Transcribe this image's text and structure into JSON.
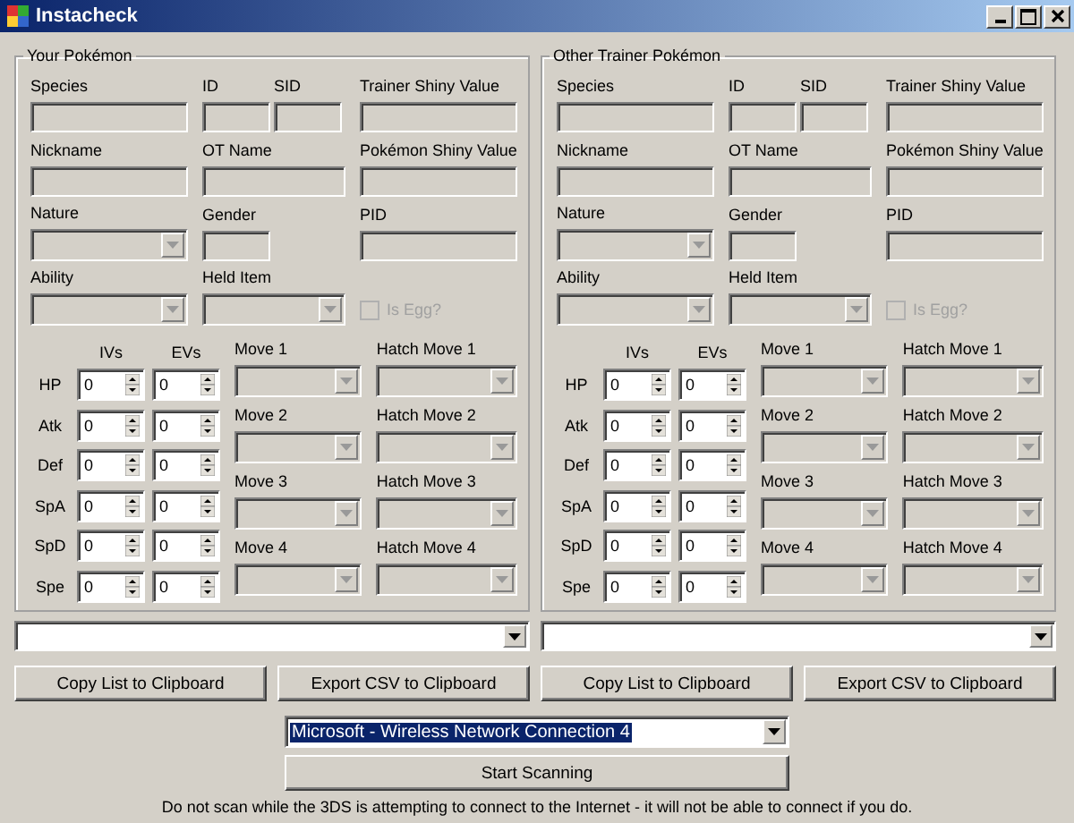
{
  "window": {
    "title": "Instacheck"
  },
  "panels": [
    {
      "title": "Your Pokémon",
      "rows": [
        [
          {
            "label": "Species",
            "kind": "text"
          },
          {
            "label": "ID",
            "kind": "short-text"
          },
          {
            "label": "SID",
            "kind": "short-text"
          },
          {
            "label": "Trainer Shiny Value",
            "kind": "text"
          }
        ],
        [
          {
            "label": "Nickname",
            "kind": "text"
          },
          {
            "label": "OT Name",
            "kind": "wide-text"
          },
          {
            "label": "Pokémon Shiny Value",
            "kind": "text"
          }
        ],
        [
          {
            "label": "Nature",
            "kind": "combo"
          },
          {
            "label": "Gender",
            "kind": "short-text"
          },
          {
            "label": "PID",
            "kind": "text"
          }
        ],
        [
          {
            "label": "Ability",
            "kind": "combo"
          },
          {
            "label": "Held Item",
            "kind": "wide-combo"
          },
          {
            "label": "Is Egg?",
            "kind": "checkbox",
            "checked": false,
            "disabled": true
          }
        ]
      ],
      "iv_heading": "IVs",
      "ev_heading": "EVs",
      "stats": [
        {
          "label": "HP",
          "iv": "0",
          "ev": "0"
        },
        {
          "label": "Atk",
          "iv": "0",
          "ev": "0"
        },
        {
          "label": "Def",
          "iv": "0",
          "ev": "0"
        },
        {
          "label": "SpA",
          "iv": "0",
          "ev": "0"
        },
        {
          "label": "SpD",
          "iv": "0",
          "ev": "0"
        },
        {
          "label": "Spe",
          "iv": "0",
          "ev": "0"
        }
      ],
      "moves": [
        "Move 1",
        "Move 2",
        "Move 3",
        "Move 4"
      ],
      "hatch_moves": [
        "Hatch Move 1",
        "Hatch Move 2",
        "Hatch Move 3",
        "Hatch Move 4"
      ]
    },
    {
      "title": "Other Trainer Pokémon",
      "rows": [
        [
          {
            "label": "Species",
            "kind": "text"
          },
          {
            "label": "ID",
            "kind": "short-text"
          },
          {
            "label": "SID",
            "kind": "short-text"
          },
          {
            "label": "Trainer Shiny Value",
            "kind": "text"
          }
        ],
        [
          {
            "label": "Nickname",
            "kind": "text"
          },
          {
            "label": "OT Name",
            "kind": "wide-text"
          },
          {
            "label": "Pokémon Shiny Value",
            "kind": "text"
          }
        ],
        [
          {
            "label": "Nature",
            "kind": "combo"
          },
          {
            "label": "Gender",
            "kind": "short-text"
          },
          {
            "label": "PID",
            "kind": "text"
          }
        ],
        [
          {
            "label": "Ability",
            "kind": "combo"
          },
          {
            "label": "Held Item",
            "kind": "wide-combo"
          },
          {
            "label": "Is Egg?",
            "kind": "checkbox",
            "checked": false,
            "disabled": true
          }
        ]
      ],
      "iv_heading": "IVs",
      "ev_heading": "EVs",
      "stats": [
        {
          "label": "HP",
          "iv": "0",
          "ev": "0"
        },
        {
          "label": "Atk",
          "iv": "0",
          "ev": "0"
        },
        {
          "label": "Def",
          "iv": "0",
          "ev": "0"
        },
        {
          "label": "SpA",
          "iv": "0",
          "ev": "0"
        },
        {
          "label": "SpD",
          "iv": "0",
          "ev": "0"
        },
        {
          "label": "Spe",
          "iv": "0",
          "ev": "0"
        }
      ],
      "moves": [
        "Move 1",
        "Move 2",
        "Move 3",
        "Move 4"
      ],
      "hatch_moves": [
        "Hatch Move 1",
        "Hatch Move 2",
        "Hatch Move 3",
        "Hatch Move 4"
      ]
    }
  ],
  "buttons": [
    "Copy List to Clipboard",
    "Export CSV to Clipboard",
    "Copy List to Clipboard",
    "Export CSV to Clipboard"
  ],
  "network": {
    "value": "Microsoft - Wireless Network Connection 4",
    "text_selected": true
  },
  "scan_button": "Start Scanning",
  "note": "Do not scan while the 3DS is attempting to connect to the Internet - it will not be able to connect if you do."
}
